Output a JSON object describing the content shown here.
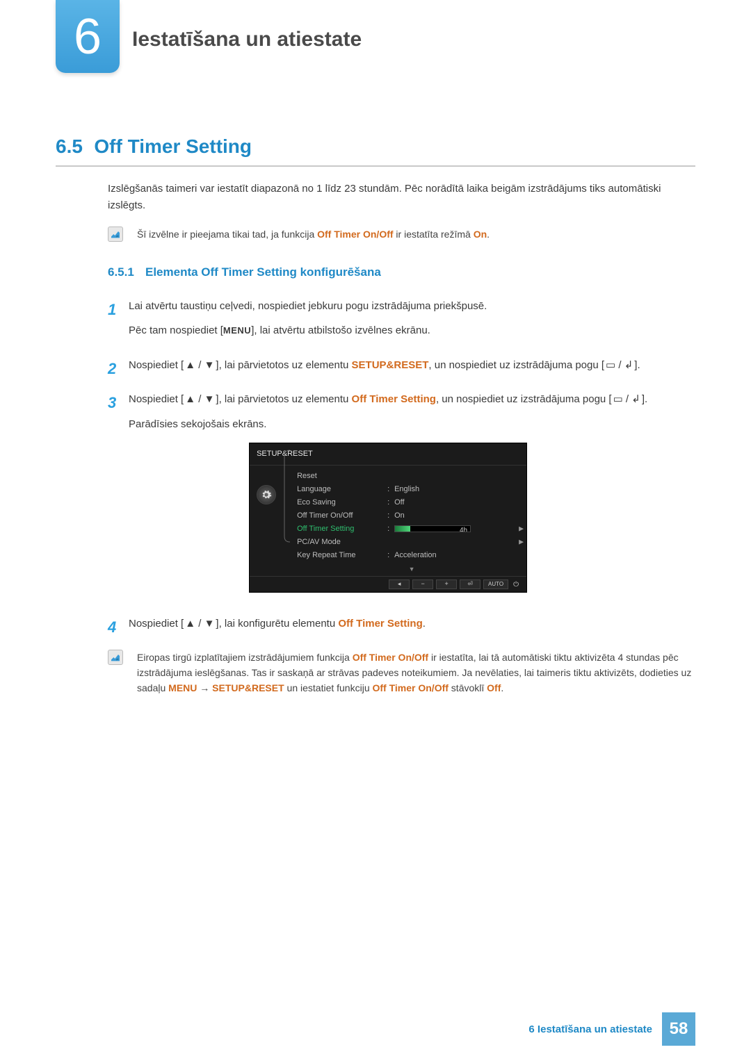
{
  "chapter": {
    "number": "6",
    "title": "Iestatīšana un atiestate"
  },
  "section": {
    "number": "6.5",
    "title": "Off Timer Setting"
  },
  "intro": "Izslēgšanās taimeri var iestatīt diapazonā no 1 līdz 23 stundām. Pēc norādītā laika beigām izstrādājums tiks automātiski izslēgts.",
  "note1": {
    "prefix": "Šī izvēlne ir pieejama tikai tad, ja funkcija ",
    "hl1": "Off Timer On/Off",
    "mid": " ir iestatīta režīmā ",
    "hl2": "On",
    "suffix": "."
  },
  "subsection": {
    "number": "6.5.1",
    "title": "Elementa Off Timer Setting konfigurēšana"
  },
  "steps": {
    "s1": {
      "idx": "1",
      "p1": "Lai atvērtu taustiņu ceļvedi, nospiediet jebkuru pogu izstrādājuma priekšpusē.",
      "p2a": "Pēc tam nospiediet [",
      "menu": "MENU",
      "p2b": "], lai atvērtu atbilstošo izvēlnes ekrānu."
    },
    "s2": {
      "idx": "2",
      "a": "Nospiediet [",
      "b": "], lai pārvietotos uz elementu ",
      "hl": "SETUP&RESET",
      "c": ", un nospiediet uz izstrādājuma pogu [",
      "d": "]."
    },
    "s3": {
      "idx": "3",
      "a": "Nospiediet [",
      "b": "], lai pārvietotos uz elementu ",
      "hl": "Off Timer Setting",
      "c": ", un nospiediet uz izstrādājuma pogu [",
      "d": "].",
      "p2": "Parādīsies sekojošais ekrāns."
    },
    "s4": {
      "idx": "4",
      "a": "Nospiediet [",
      "b": "], lai konfigurētu elementu ",
      "hl": "Off Timer Setting",
      "c": "."
    }
  },
  "osd": {
    "title": "SETUP&RESET",
    "rows": [
      {
        "label": "Reset",
        "val": ""
      },
      {
        "label": "Language",
        "val": "English"
      },
      {
        "label": "Eco Saving",
        "val": "Off"
      },
      {
        "label": "Off Timer On/Off",
        "val": "On"
      },
      {
        "label": "Off Timer Setting",
        "val": "4h",
        "active": true
      },
      {
        "label": "PC/AV Mode",
        "val": ""
      },
      {
        "label": "Key Repeat Time",
        "val": "Acceleration"
      }
    ],
    "footer_auto": "AUTO"
  },
  "note2": {
    "p1a": "Eiropas tirgū izplatītajiem izstrādājumiem funkcija ",
    "hl1": "Off Timer On/Off",
    "p1b": " ir iestatīta, lai tā automātiski tiktu aktivizēta 4 stundas pēc izstrādājuma ieslēgšanas. Tas ir saskaņā ar strāvas padeves noteikumiem. Ja nevēlaties, lai taimeris tiktu aktivizēts, dodieties uz sadaļu ",
    "hl2": "MENU",
    "arrow": " → ",
    "hl3": "SETUP&RESET",
    "p1c": " un iestatiet funkciju ",
    "hl4": "Off Timer On/Off",
    "p1d": " stāvoklī ",
    "hl5": "Off",
    "p1e": "."
  },
  "footer": {
    "text": "6 Iestatīšana un atiestate",
    "page": "58"
  }
}
